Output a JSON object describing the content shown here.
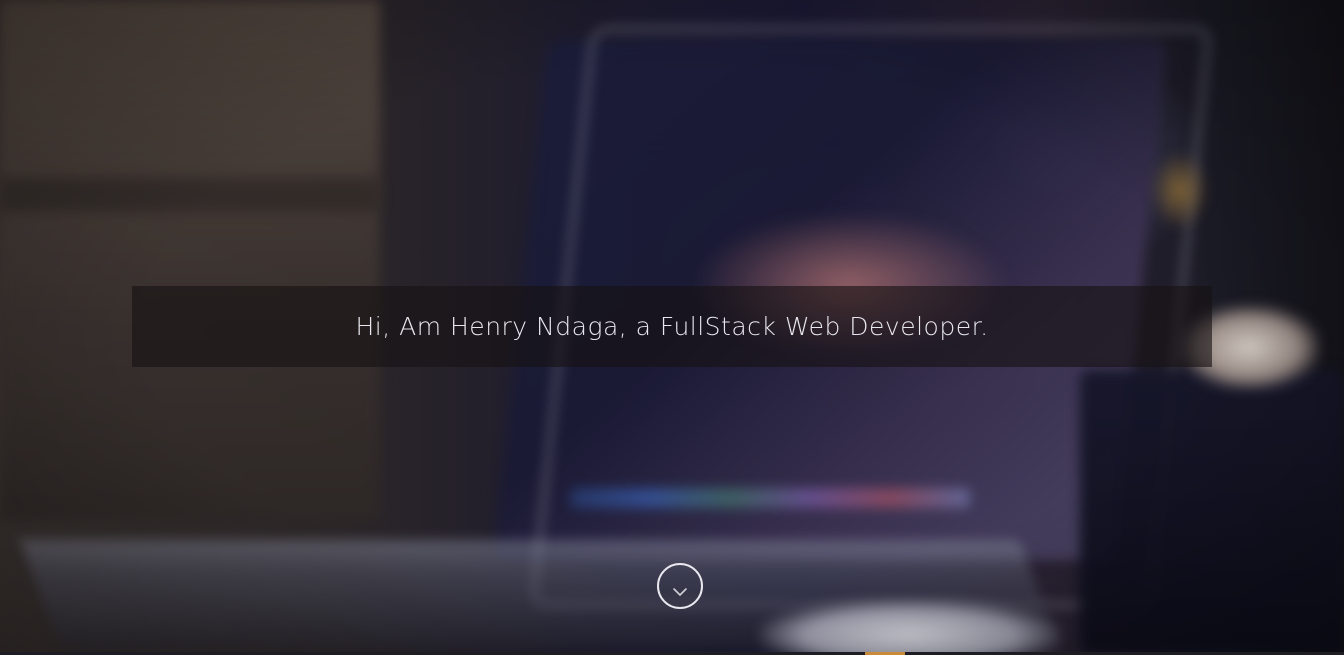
{
  "hero": {
    "headline": "Hi, Am Henry Ndaga, a FullStack Web Developer."
  },
  "scroll_button": {
    "icon": "chevron-down-icon"
  }
}
